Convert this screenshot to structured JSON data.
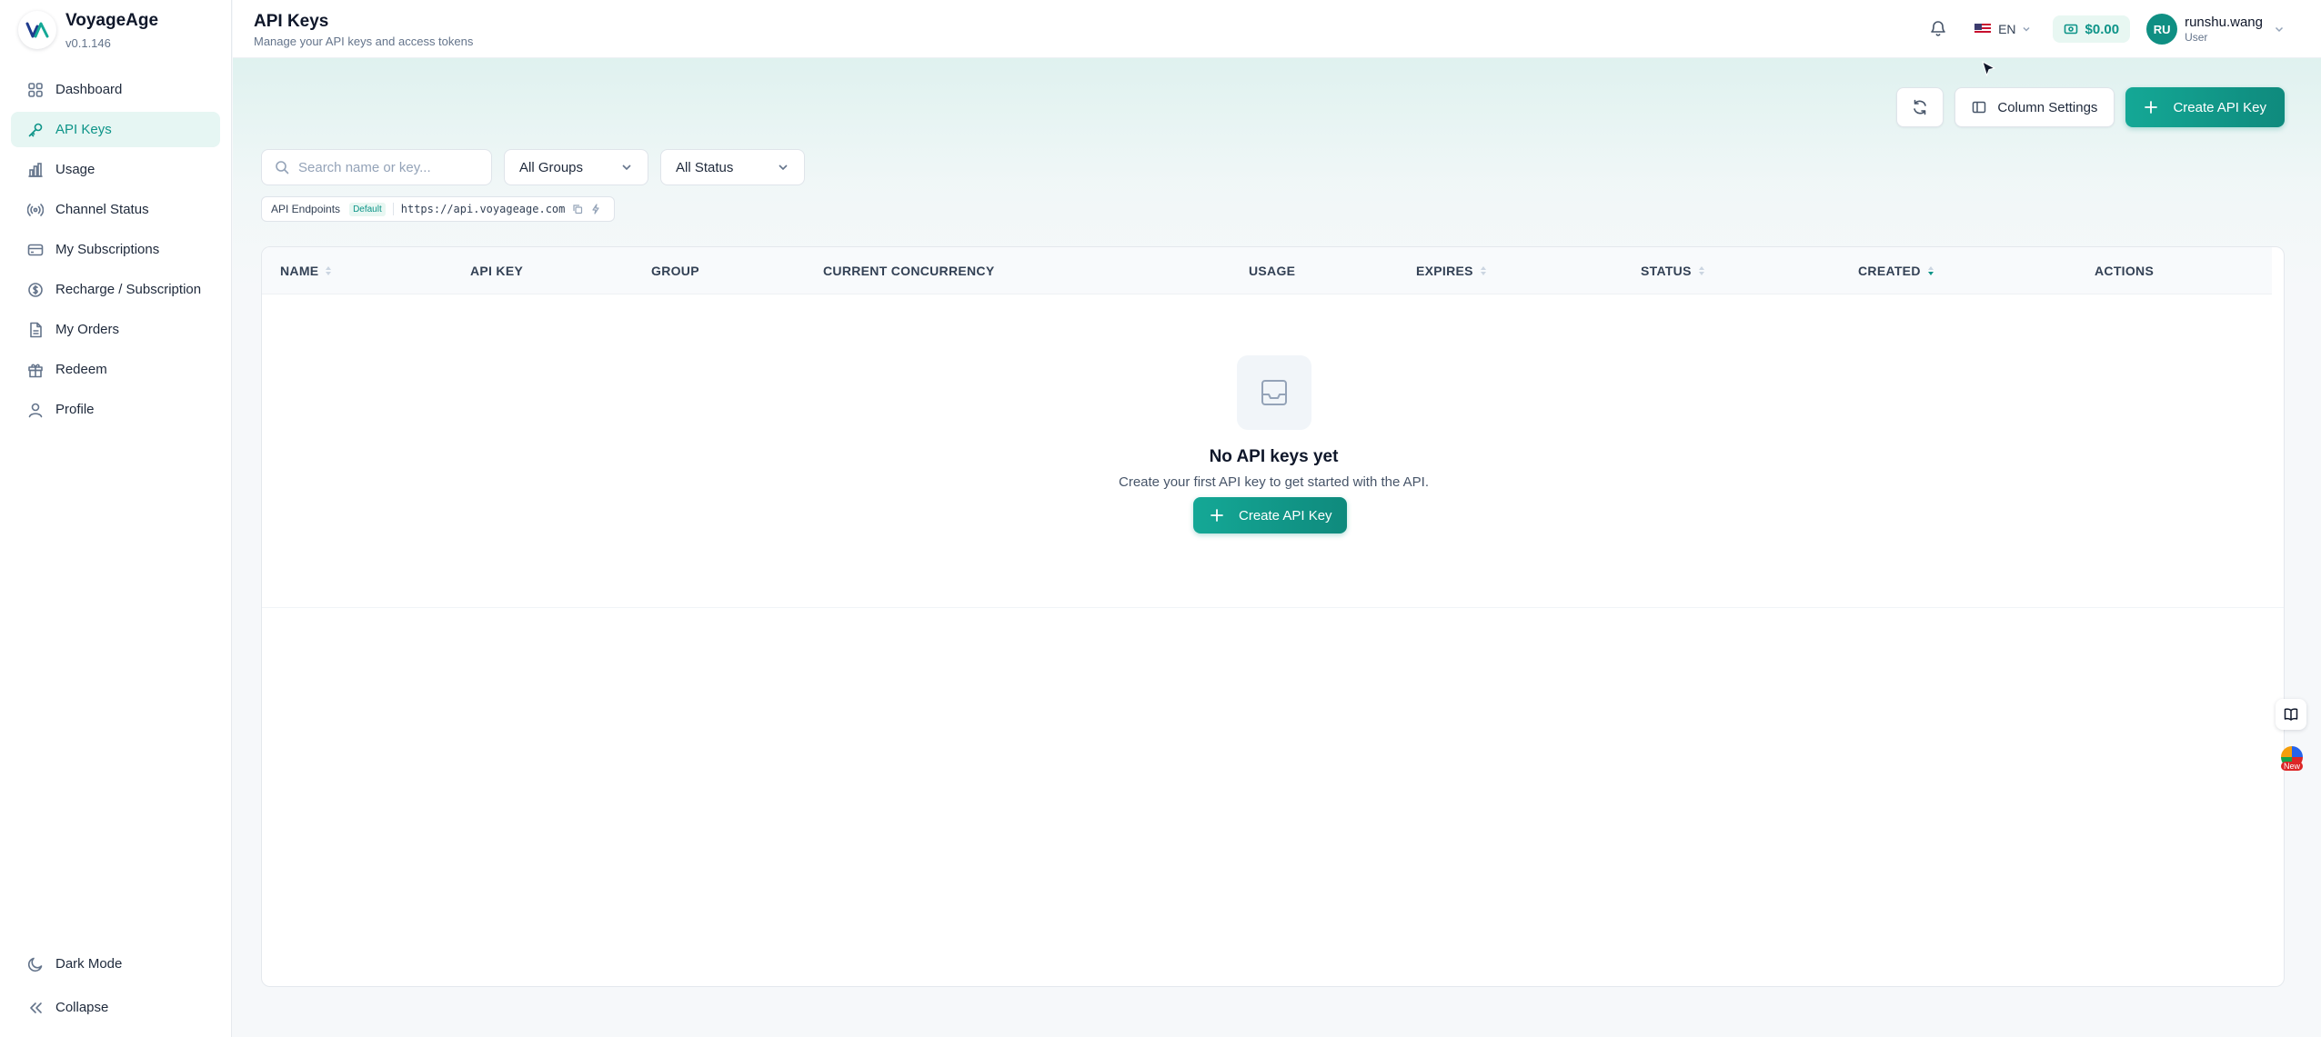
{
  "brand": {
    "name": "VoyageAge",
    "version": "v0.1.146"
  },
  "sidebar": {
    "items": [
      {
        "label": "Dashboard",
        "icon": "grid-icon"
      },
      {
        "label": "API Keys",
        "icon": "key-icon",
        "active": true
      },
      {
        "label": "Usage",
        "icon": "bar-chart-icon"
      },
      {
        "label": "Channel Status",
        "icon": "signal-icon"
      },
      {
        "label": "My Subscriptions",
        "icon": "credit-card-icon"
      },
      {
        "label": "Recharge / Subscription",
        "icon": "coin-icon"
      },
      {
        "label": "My Orders",
        "icon": "document-icon"
      },
      {
        "label": "Redeem",
        "icon": "gift-icon"
      },
      {
        "label": "Profile",
        "icon": "user-icon"
      }
    ],
    "bottom": {
      "dark_mode": "Dark Mode",
      "collapse": "Collapse"
    }
  },
  "header": {
    "title": "API Keys",
    "subtitle": "Manage your API keys and access tokens",
    "language": "EN",
    "balance": "$0.00",
    "user": {
      "initials": "RU",
      "name": "runshu.wang",
      "role": "User"
    }
  },
  "toolbar": {
    "column_settings": "Column Settings",
    "create_label": "Create API Key"
  },
  "filters": {
    "search_placeholder": "Search name or key...",
    "groups_value": "All Groups",
    "status_value": "All Status"
  },
  "endpoint": {
    "label": "API Endpoints",
    "badge": "Default",
    "url": "https://api.voyageage.com"
  },
  "table": {
    "columns": [
      "NAME",
      "API KEY",
      "GROUP",
      "CURRENT CONCURRENCY",
      "USAGE",
      "EXPIRES",
      "STATUS",
      "CREATED",
      "ACTIONS"
    ],
    "sort_active": "CREATED"
  },
  "empty": {
    "title": "No API keys yet",
    "subtitle": "Create your first API key to get started with the API.",
    "button": "Create API Key"
  },
  "floating": {
    "new_badge": "New"
  },
  "colors": {
    "accent": "#0d9488",
    "accent_light": "#e6f6f3"
  }
}
